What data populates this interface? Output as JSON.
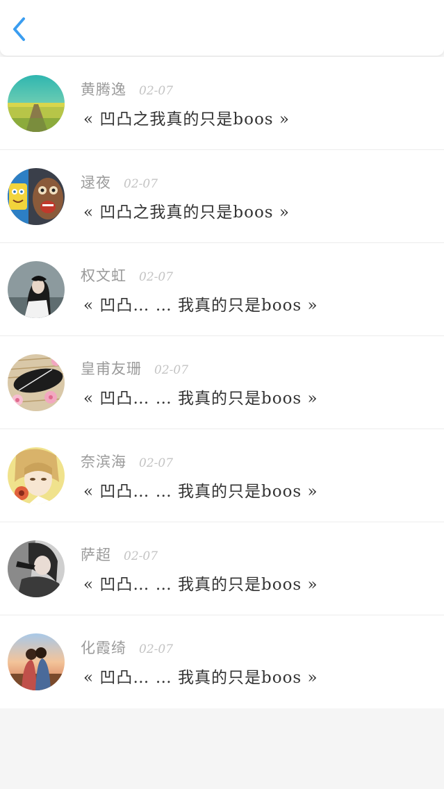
{
  "header": {
    "back_icon": "chevron-left-icon",
    "accent_color": "#3a9df0"
  },
  "items": [
    {
      "name": "黄腾逸",
      "time": "02-07",
      "message": "« 凹凸之我真的只是boos »",
      "avatar": "landscape-field"
    },
    {
      "name": "逯夜",
      "time": "02-07",
      "message": "« 凹凸之我真的只是boos »",
      "avatar": "cartoon"
    },
    {
      "name": "权文虹",
      "time": "02-07",
      "message": "« 凹凸… … 我真的只是boos »",
      "avatar": "girl-dark"
    },
    {
      "name": "皇甫友珊",
      "time": "02-07",
      "message": "« 凹凸… … 我真的只是boos »",
      "avatar": "flowers-fan"
    },
    {
      "name": "奈滨海",
      "time": "02-07",
      "message": "« 凹凸… … 我真的只是boos »",
      "avatar": "anime-boy"
    },
    {
      "name": "萨超",
      "time": "02-07",
      "message": "« 凹凸… … 我真的只是boos »",
      "avatar": "dark-portrait"
    },
    {
      "name": "化霞绮",
      "time": "02-07",
      "message": "« 凹凸… … 我真的只是boos »",
      "avatar": "sunset-couple"
    }
  ]
}
